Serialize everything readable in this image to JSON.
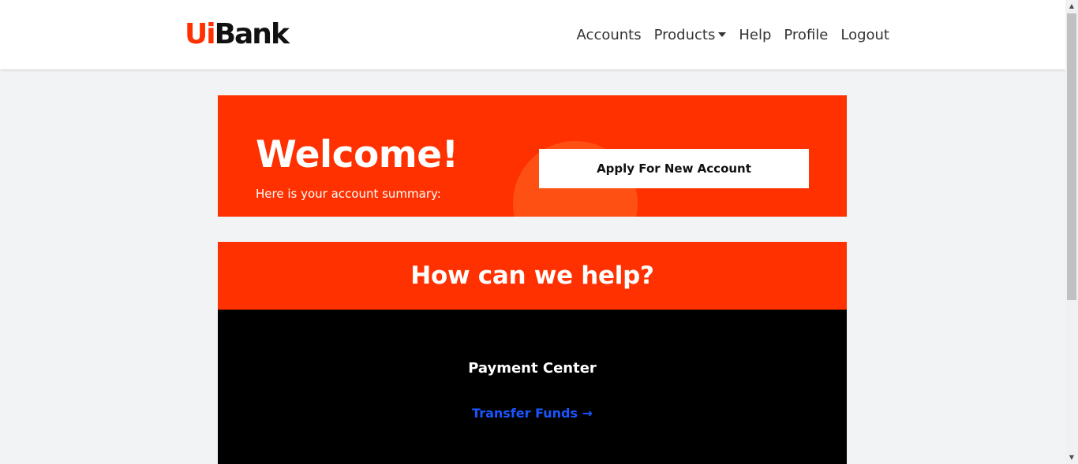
{
  "brand": {
    "logo_part1": "Ui",
    "logo_part2": "Bank",
    "accent_color": "#ff3100"
  },
  "nav": {
    "items": [
      {
        "label": "Accounts"
      },
      {
        "label": "Products"
      },
      {
        "label": "Help"
      },
      {
        "label": "Profile"
      },
      {
        "label": "Logout"
      }
    ]
  },
  "welcome": {
    "title": "Welcome!",
    "subtitle": "Here is your account summary:",
    "apply_button": "Apply For New Account"
  },
  "help": {
    "title": "How can we help?",
    "section_title": "Payment Center",
    "link_label": "Transfer Funds →",
    "link_color": "#1a56ff"
  },
  "scrollbar": {
    "up_icon": "▲",
    "down_icon": "▼"
  }
}
